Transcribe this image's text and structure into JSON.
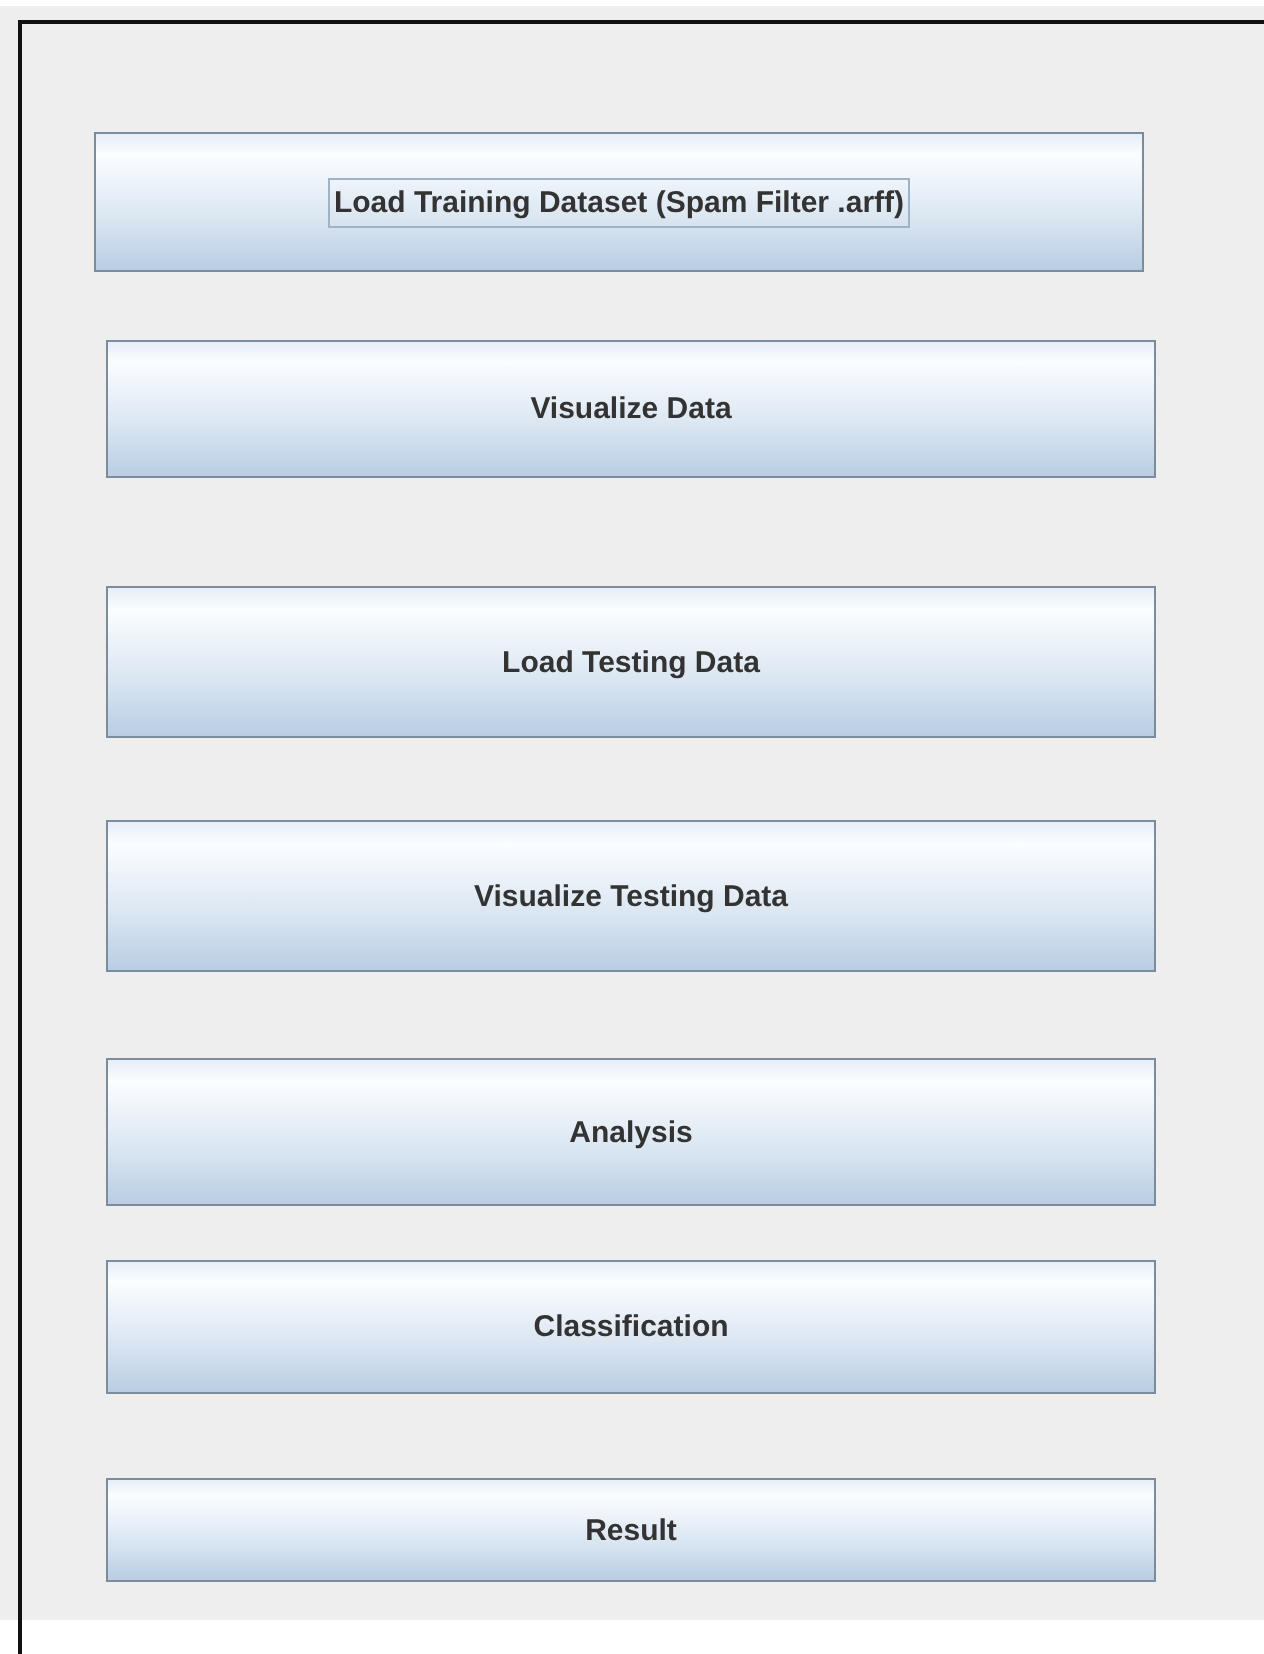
{
  "buttons": [
    {
      "label": "Load Training Dataset (Spam Filter .arff)",
      "focused": true
    },
    {
      "label": "Visualize Data",
      "focused": false
    },
    {
      "label": "Load Testing Data",
      "focused": false
    },
    {
      "label": "Visualize Testing  Data",
      "focused": false
    },
    {
      "label": "Analysis",
      "focused": false
    },
    {
      "label": "Classification",
      "focused": false
    },
    {
      "label": "Result",
      "focused": false
    }
  ]
}
